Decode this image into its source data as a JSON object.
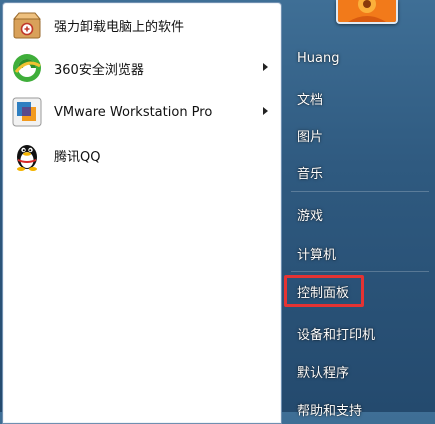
{
  "programs": [
    {
      "label": "强力卸载电脑上的软件",
      "icon": "uninstall-box-icon",
      "has_submenu": false
    },
    {
      "label": "360安全浏览器",
      "icon": "browser-360-icon",
      "has_submenu": true
    },
    {
      "label": "VMware Workstation Pro",
      "icon": "vmware-icon",
      "has_submenu": true
    },
    {
      "label": "腾讯QQ",
      "icon": "qq-penguin-icon",
      "has_submenu": false
    }
  ],
  "right_pane": {
    "user_name": "Huang",
    "items": [
      {
        "label": "文档"
      },
      {
        "label": "图片"
      },
      {
        "label": "音乐"
      },
      {
        "label": "游戏"
      },
      {
        "label": "计算机"
      },
      {
        "label": "控制面板"
      },
      {
        "label": "设备和打印机"
      },
      {
        "label": "默认程序"
      },
      {
        "label": "帮助和支持"
      }
    ]
  },
  "highlighted_item": "控制面板",
  "colors": {
    "highlight_border": "#e53333",
    "pane_background": "#ffffff",
    "right_pane_text": "#ffffff"
  }
}
